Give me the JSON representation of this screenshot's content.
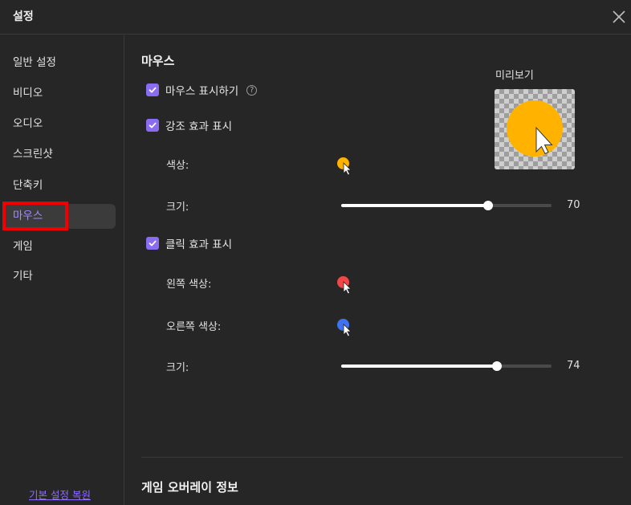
{
  "window": {
    "title": "설정"
  },
  "sidebar": {
    "items": [
      {
        "label": "일반 설정",
        "active": false
      },
      {
        "label": "비디오",
        "active": false
      },
      {
        "label": "오디오",
        "active": false
      },
      {
        "label": "스크린샷",
        "active": false
      },
      {
        "label": "단축키",
        "active": false
      },
      {
        "label": "마우스",
        "active": true
      },
      {
        "label": "게임",
        "active": false
      },
      {
        "label": "기타",
        "active": false
      }
    ],
    "reset_label": "기본 설정 복원"
  },
  "mouse": {
    "section_title": "마우스",
    "show_mouse": {
      "label": "마우스 표시하기",
      "checked": true,
      "help_glyph": "?"
    },
    "highlight": {
      "label": "강조 효과 표시",
      "checked": true,
      "color_label": "색상:",
      "color": "#ffb300",
      "size_label": "크기:",
      "size": 70,
      "size_fraction": 0.7
    },
    "click": {
      "label": "클릭 효과 표시",
      "checked": true,
      "left_color_label": "왼쪽 색상:",
      "left_color": "#f04848",
      "right_color_label": "오른쪽 색상:",
      "right_color": "#3f72f0",
      "size_label": "크기:",
      "size": 74,
      "size_fraction": 0.74
    },
    "preview": {
      "label": "미리보기",
      "circle_color": "#ffb300"
    }
  },
  "game_overlay": {
    "section_title": "게임 오버레이 정보"
  },
  "colors": {
    "accent": "#8a6cf0",
    "active_text": "#a58bff",
    "highlight_box": "#f00000"
  }
}
